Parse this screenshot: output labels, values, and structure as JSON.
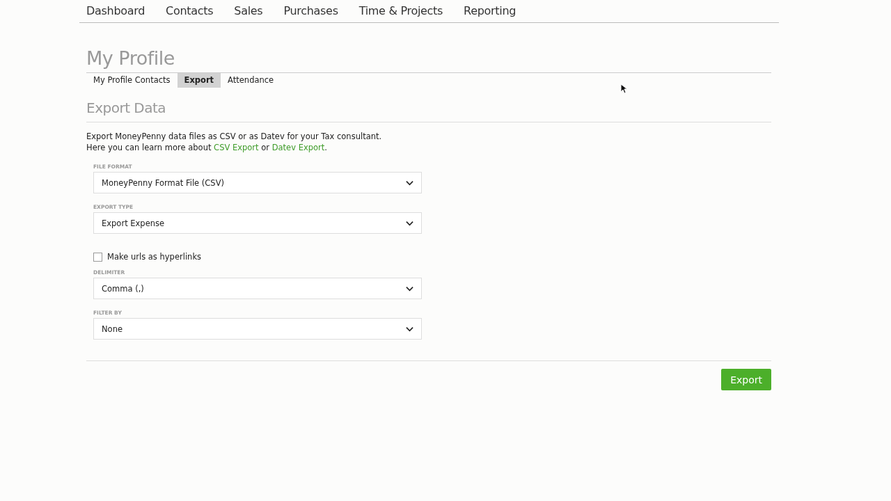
{
  "nav": [
    {
      "label": "Dashboard"
    },
    {
      "label": "Contacts"
    },
    {
      "label": "Sales"
    },
    {
      "label": "Purchases"
    },
    {
      "label": "Time & Projects"
    },
    {
      "label": "Reporting"
    }
  ],
  "page_title": "My Profile",
  "tabs": [
    {
      "label": "My Profile Contacts",
      "selected": false
    },
    {
      "label": "Export",
      "selected": true
    },
    {
      "label": "Attendance",
      "selected": false
    }
  ],
  "section_title": "Export Data",
  "intro": {
    "line_1": "Export MoneyPenny data files as CSV or as Datev for your Tax consultant.",
    "line_2_prefix": "Here you can learn more about",
    "link_1": "CSV Export",
    "joiner": "or",
    "link_2": "Datev Export",
    "suffix": "."
  },
  "form": [
    {
      "kind": "select",
      "label": "FILE FORMAT",
      "value": "MoneyPenny Format File (CSV)"
    },
    {
      "kind": "select",
      "label": "EXPORT TYPE",
      "value": "Export Expense"
    },
    {
      "kind": "checkbox",
      "label": "Make urls as hyperlinks",
      "checked": false
    },
    {
      "kind": "select",
      "label": "DELIMITER",
      "value": "Comma (,)"
    },
    {
      "kind": "select",
      "label": "FILTER BY",
      "value": "None"
    }
  ],
  "export_button": "Export"
}
